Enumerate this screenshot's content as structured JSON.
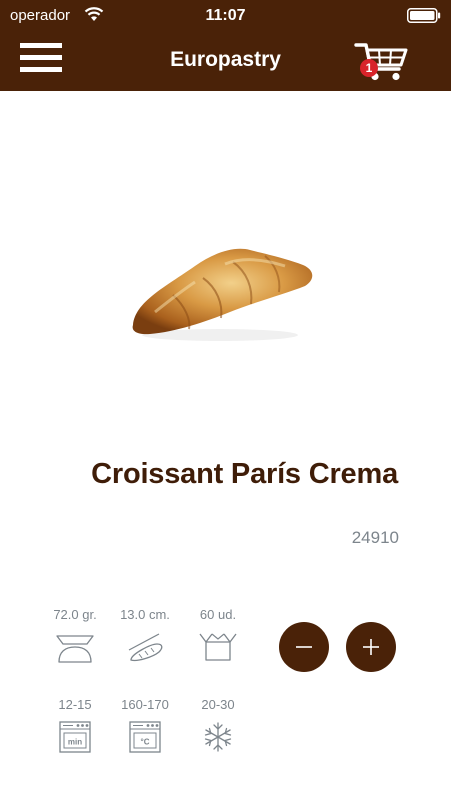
{
  "status_bar": {
    "carrier": "operador",
    "time": "11:07"
  },
  "header": {
    "title": "Europastry",
    "cart_count": "1",
    "background_color": "#4a2208"
  },
  "product": {
    "name": "Croissant París Crema",
    "code": "24910",
    "specs": [
      {
        "value": "72.0 gr.",
        "icon": "scale-icon"
      },
      {
        "value": "13.0 cm.",
        "icon": "length-icon"
      },
      {
        "value": "60 ud.",
        "icon": "box-icon"
      },
      {
        "value": "12-15",
        "icon": "oven-timer-icon",
        "icon_text": "min"
      },
      {
        "value": "160-170",
        "icon": "oven-temperature-icon",
        "icon_text": "°C"
      },
      {
        "value": "20-30",
        "icon": "snowflake-icon"
      }
    ]
  },
  "quantity": {
    "decrease_icon": "minus-icon",
    "increase_icon": "plus-icon"
  }
}
